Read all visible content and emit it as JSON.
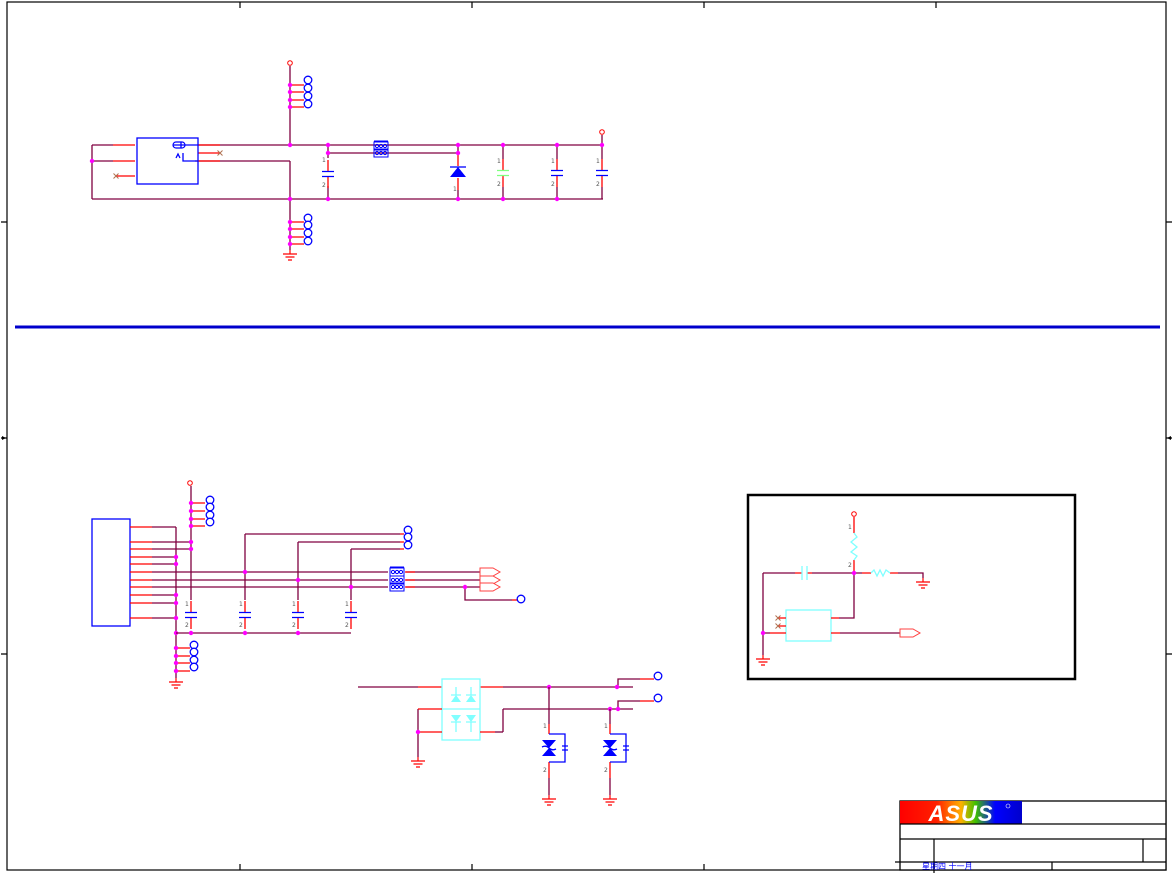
{
  "title_block": {
    "logo_text": "ASUS",
    "date_text": "星期四 十一月"
  },
  "colors": {
    "wire": "#800040",
    "pin": "#ff0000",
    "junction": "#ff00ff",
    "component": "#0000ff",
    "component_alt": "#80ffff",
    "capacitor_green": "#80ff80",
    "section_divider": "#0000cc"
  },
  "icons": {
    "power": "power-symbol-icon",
    "ground": "ground-symbol-icon",
    "port": "offpage-port-icon"
  },
  "pin_labels": {
    "one": "1",
    "two": "2"
  }
}
